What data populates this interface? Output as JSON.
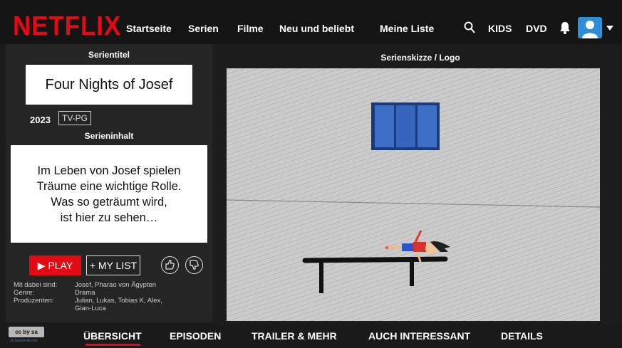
{
  "brand": {
    "logo": "NETFLIX",
    "accent": "#e50914"
  },
  "nav": {
    "items": [
      "Startseite",
      "Serien",
      "Filme",
      "Neu und beliebt",
      "Meine Liste"
    ],
    "kids": "KIDS",
    "dvd": "DVD",
    "icons": [
      "search-icon",
      "bell-icon",
      "avatar",
      "chevron-down-icon"
    ]
  },
  "left": {
    "title_label": "Serientitel",
    "title": "Four Nights of Josef",
    "year": "2023",
    "rating": "TV-PG",
    "synopsis_label": "Serieninhalt",
    "synopsis_lines": [
      "Im Leben von Josef spielen",
      "Träume eine wichtige Rolle.",
      "Was so geträumt wird,",
      "ist hier zu sehen…"
    ],
    "play_label": "PLAY",
    "mylist_label": "+ MY LIST",
    "meta": {
      "cast_label": "Mit dabei sind:",
      "cast_value": "Josef, Pharao von Ägypten",
      "genre_label": "Genre:",
      "genre_value": "Drama",
      "producers_label": "Produzenten:",
      "producers_value_1": "Julian, Lukas, Tobias K, Alex,",
      "producers_value_2": "Gian-Luca"
    }
  },
  "right": {
    "label": "Serienskizze / Logo"
  },
  "tabs": [
    "ÜBERSICHT",
    "EPISODEN",
    "TRAILER & MEHR",
    "AUCH INTERESSANT",
    "DETAILS"
  ],
  "active_tab": "ÜBERSICHT",
  "license": {
    "badge": "cc by sa",
    "source": "ZuTeachFolio.net"
  }
}
